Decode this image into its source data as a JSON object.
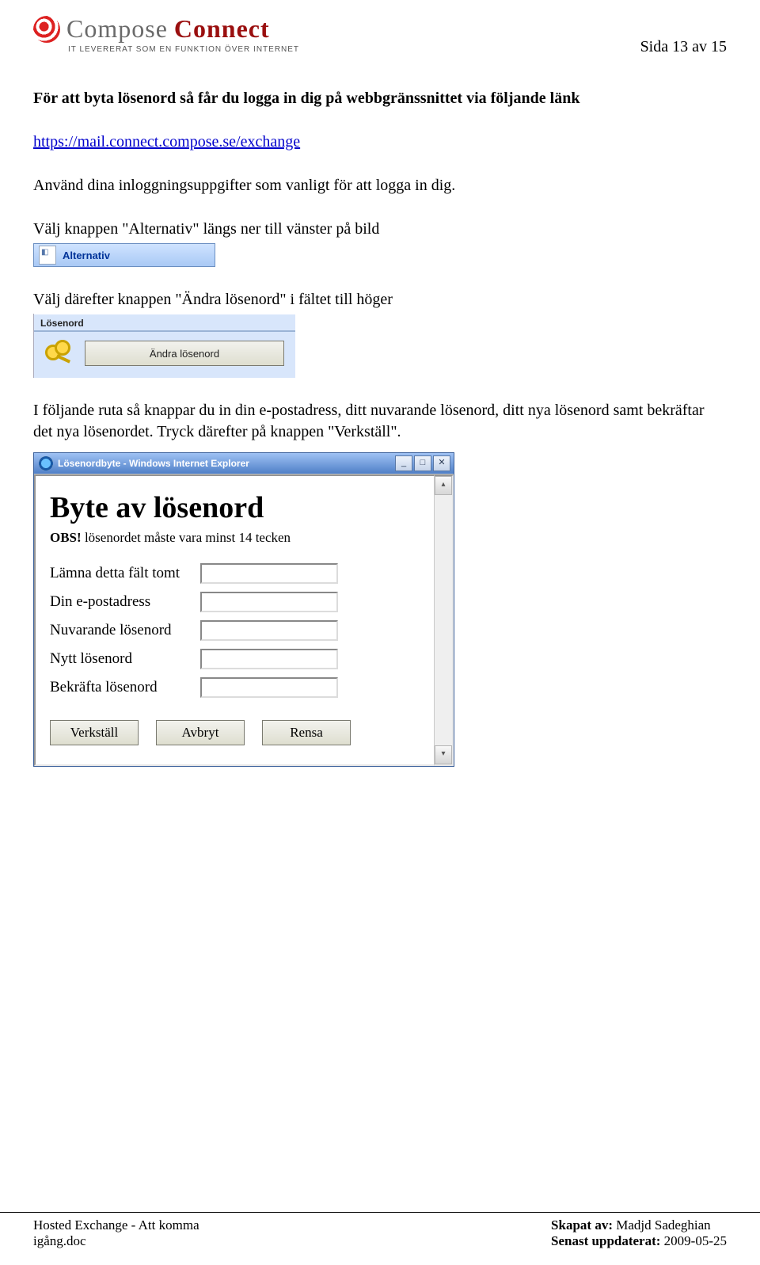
{
  "header": {
    "logo_word1": "Compose",
    "logo_word2": "Connect",
    "logo_sub": "IT LEVERERAT SOM EN FUNKTION ÖVER INTERNET",
    "page_number": "Sida 13 av 15"
  },
  "body": {
    "heading": "För att byta lösenord så får du logga in dig på webbgränssnittet via följande länk",
    "link_text": "https://mail.connect.compose.se/exchange",
    "para1": "Använd dina inloggningsuppgifter som vanligt för att logga in dig.",
    "para2": "Välj knappen \"Alternativ\" längs ner till vänster på bild",
    "alt_button_label": "Alternativ",
    "para3": "Välj därefter knappen \"Ändra lösenord\" i fältet till höger",
    "pw_panel_title": "Lösenord",
    "pw_button_label": "Ändra lösenord",
    "para4": "I följande ruta så knappar du in din e-postadress, ditt nuvarande lösenord, ditt nya lösenord samt bekräftar det nya lösenordet. Tryck därefter på knappen \"Verkställ\"."
  },
  "dialog": {
    "window_title": "Lösenordbyte - Windows Internet Explorer",
    "win_min": "_",
    "win_max": "□",
    "win_close": "✕",
    "scroll_up": "▴",
    "scroll_down": "▾",
    "h1": "Byte av lösenord",
    "note_bold": "OBS!",
    "note_rest": " lösenordet måste vara minst 14 tecken",
    "fields": {
      "f1": "Lämna detta fält tomt",
      "f2": "Din e-postadress",
      "f3": "Nuvarande lösenord",
      "f4": "Nytt lösenord",
      "f5": "Bekräfta lösenord"
    },
    "buttons": {
      "apply": "Verkställ",
      "cancel": "Avbryt",
      "clear": "Rensa"
    }
  },
  "footer": {
    "left_line1": "Hosted Exchange - Att komma",
    "left_line2": "igång.doc",
    "right_label1": "Skapat av:",
    "right_val1": " Madjd Sadeghian",
    "right_label2": "Senast uppdaterat:",
    "right_val2": " 2009-05-25"
  }
}
